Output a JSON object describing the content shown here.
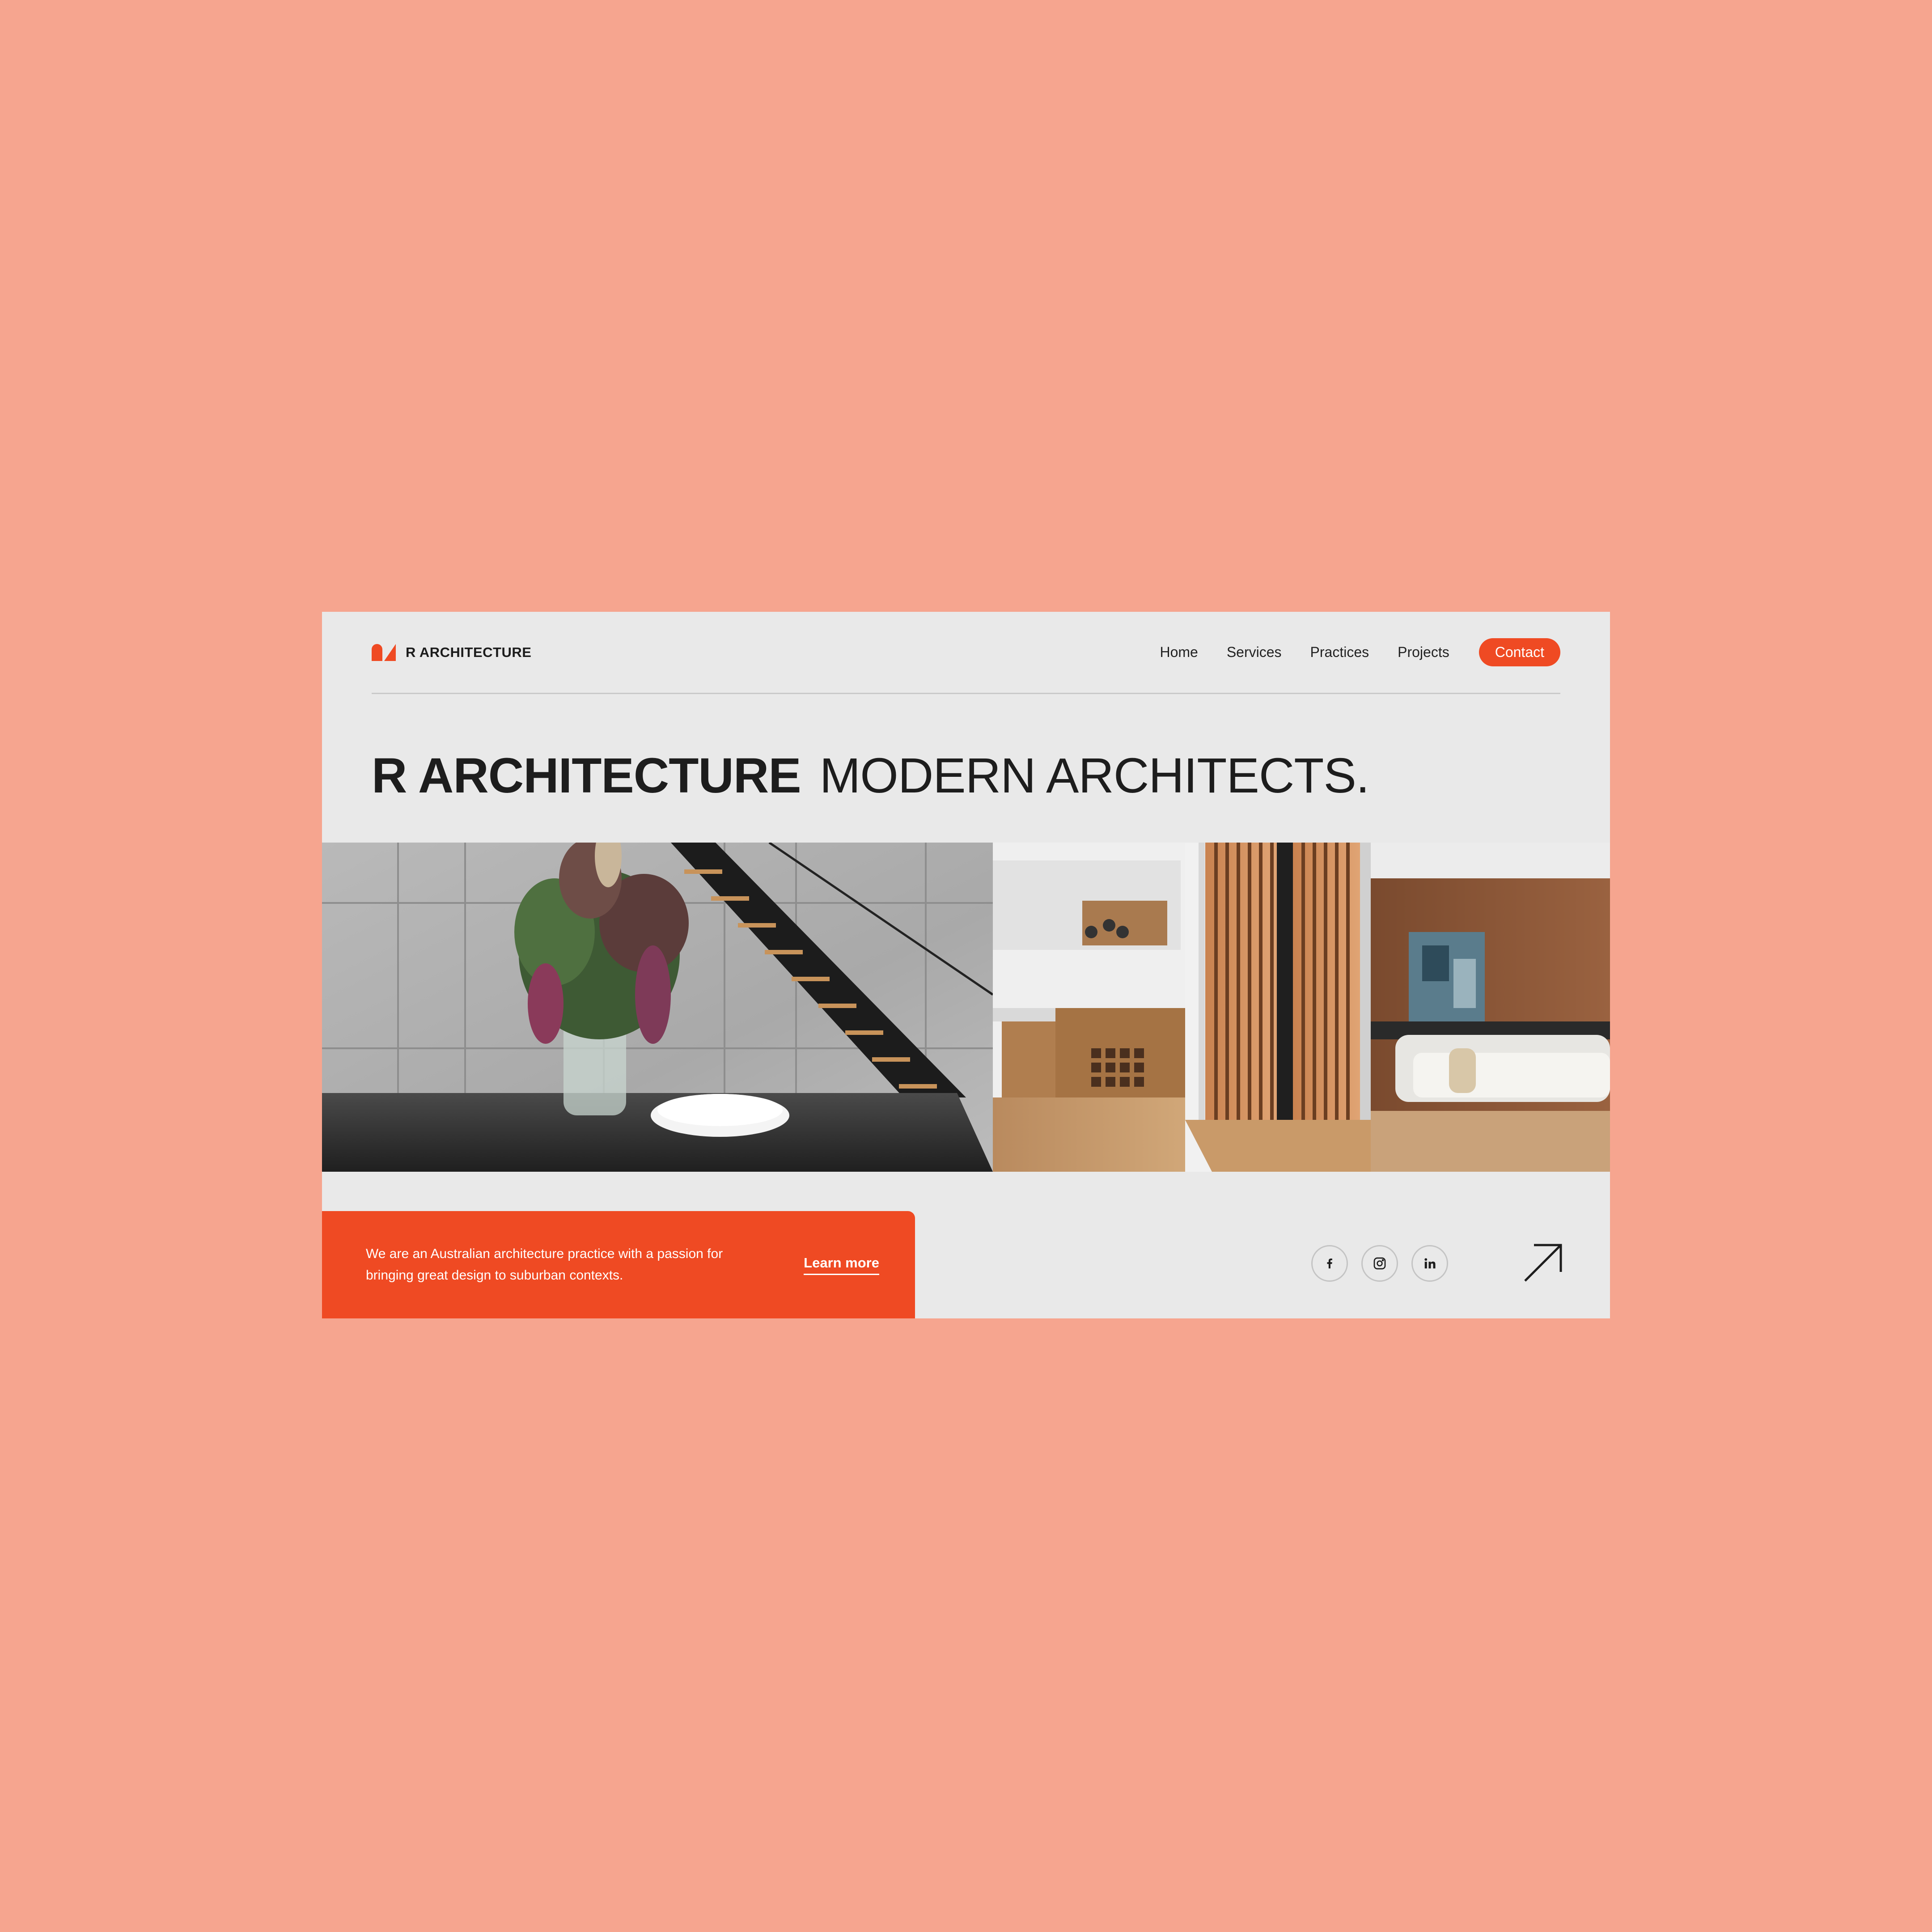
{
  "brand": {
    "name": "R ARCHITECTURE",
    "logo_icon": "r-architecture-logo-icon"
  },
  "nav": {
    "items": [
      "Home",
      "Services",
      "Practices",
      "Projects"
    ],
    "contact_label": "Contact"
  },
  "headline": {
    "bold": "R ARCHITECTURE",
    "light": "MODERN ARCHITECTS."
  },
  "hero": {
    "scenes": [
      "dining-staircase",
      "kitchen",
      "timber-screen-door",
      "living-room"
    ]
  },
  "info": {
    "text": "We are an Australian architecture practice with a passion for bringing great design to suburban contexts.",
    "link_label": "Learn more"
  },
  "socials": [
    "facebook-icon",
    "instagram-icon",
    "linkedin-icon"
  ],
  "colors": {
    "background": "#f6a58f",
    "page": "#e9e9e9",
    "accent": "#ef4a23",
    "text": "#1d1d1d"
  }
}
